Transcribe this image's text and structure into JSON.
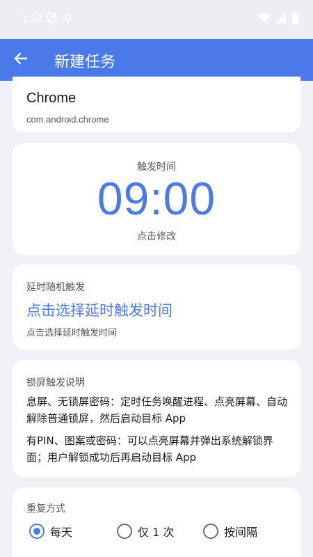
{
  "status_bar": {
    "time": "1:32",
    "icons": [
      "shield-icon",
      "notification-icon",
      "wifi-icon",
      "signal-icon",
      "battery-icon"
    ]
  },
  "app_bar": {
    "title": "新建任务",
    "back_icon": "back-arrow-icon"
  },
  "app_card": {
    "app_name": "Chrome",
    "package": "com.android.chrome"
  },
  "time_card": {
    "label": "触发时间",
    "time": "09:00",
    "hint": "点击修改"
  },
  "delay_card": {
    "label": "延时随机触发",
    "link": "点击选择延时触发时间",
    "hint": "点击选择延时触发时间"
  },
  "lock_card": {
    "label": "锁屏触发说明",
    "para1": "息屏、无锁屏密码：定时任务唤醒进程、点亮屏幕、自动解除普通锁屏，然后启动目标 App",
    "para2": "有PIN、图案或密码：可以点亮屏幕并弹出系统解锁界面；用户解锁成功后再启动目标 App"
  },
  "repeat_card": {
    "label": "重复方式",
    "options": [
      {
        "label": "每天",
        "selected": true
      },
      {
        "label": "仅 1 次",
        "selected": false
      },
      {
        "label": "按间隔",
        "selected": false
      }
    ]
  },
  "colors": {
    "accent": "#4a79ea",
    "background": "#f1f2f7",
    "card": "#ffffff"
  }
}
